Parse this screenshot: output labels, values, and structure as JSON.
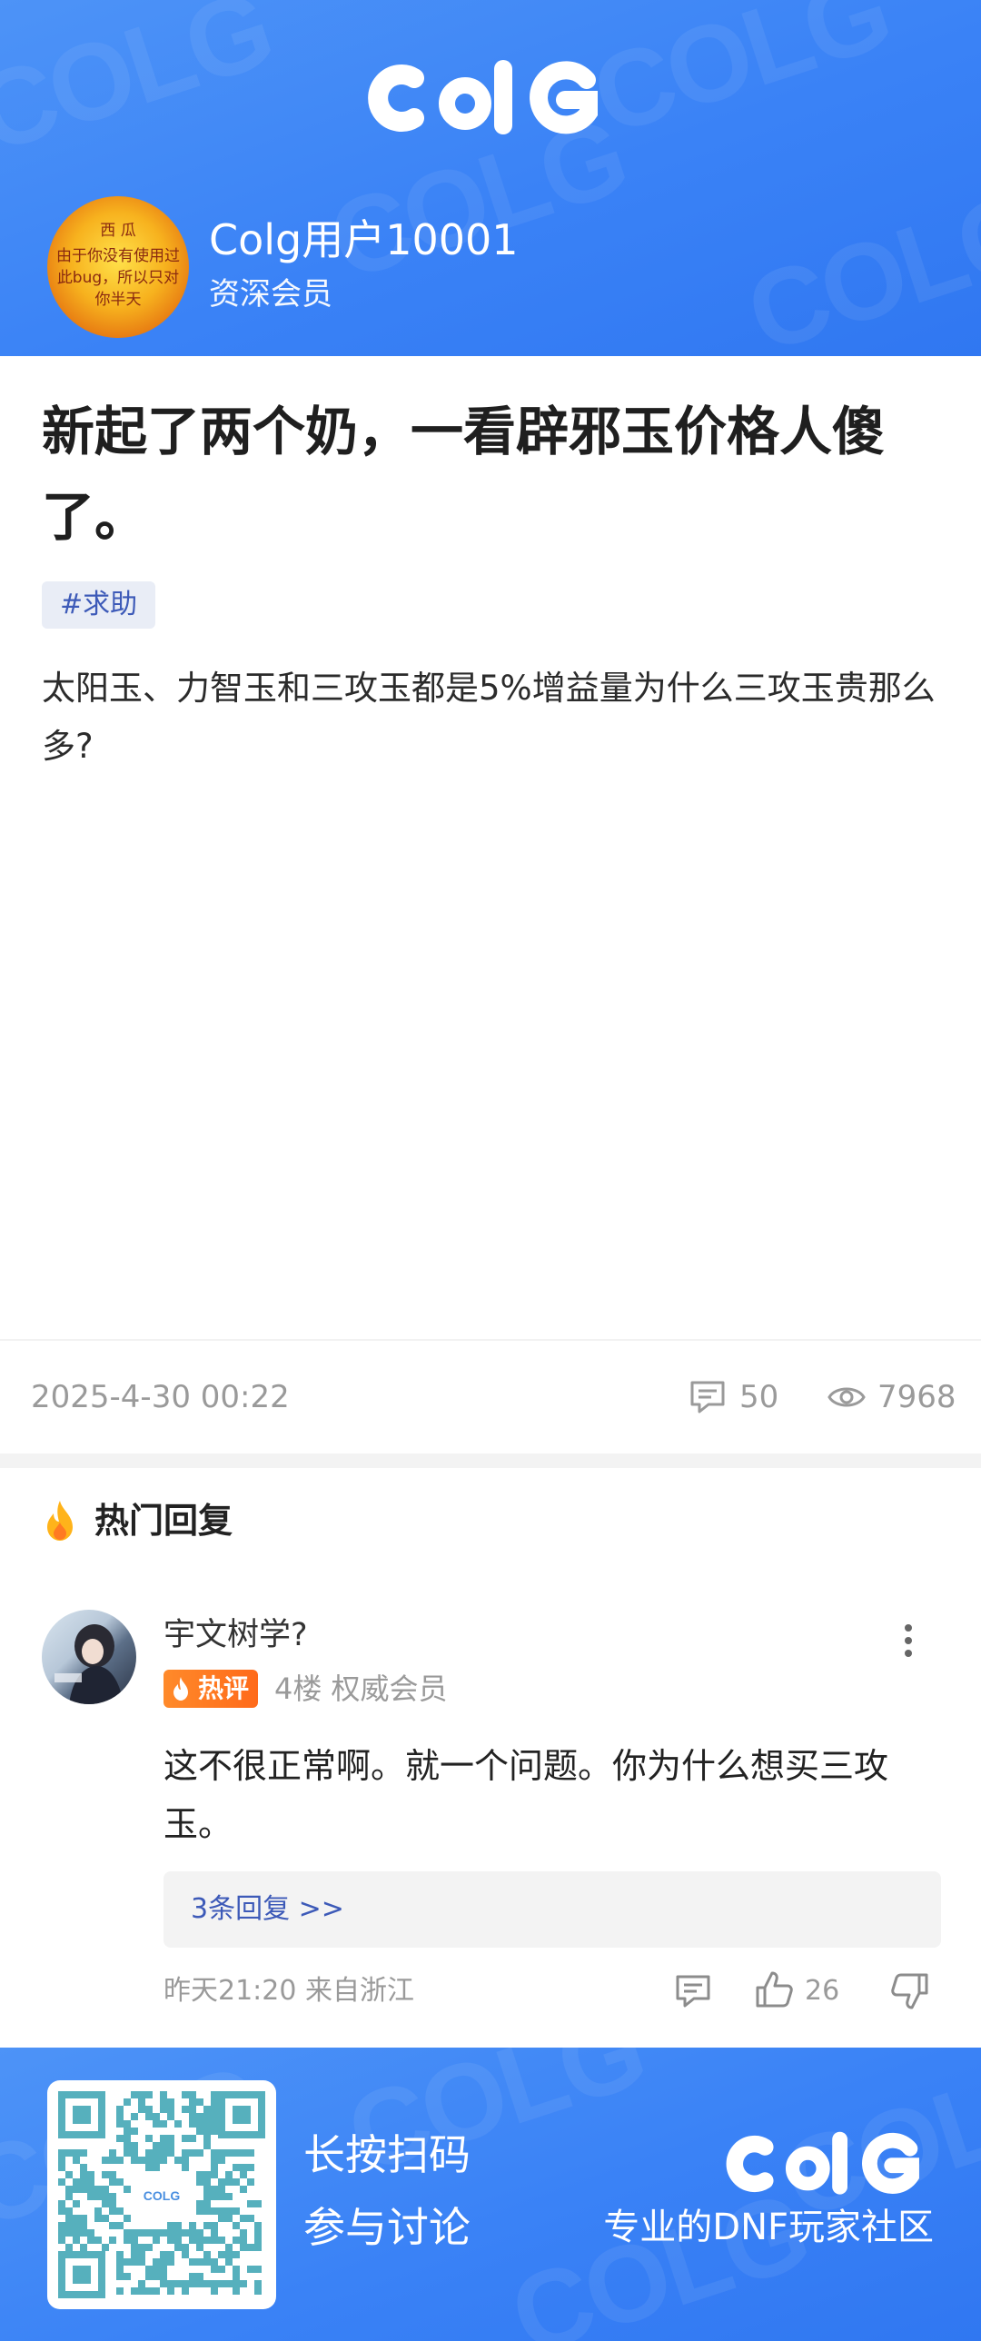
{
  "header": {
    "logo": "COLG",
    "avatar_text": [
      "西 瓜",
      "由于你没有使用过",
      "此bug，所以只对",
      "你半天"
    ],
    "username": "Colg用户10001",
    "user_level": "资深会员"
  },
  "post": {
    "title": "新起了两个奶，一看辟邪玉价格人傻了。",
    "tag": "#求助",
    "content": "太阳玉、力智玉和三攻玉都是5%增益量为什么三攻玉贵那么多?",
    "date": "2025-4-30 00:22",
    "comment_count": "50",
    "view_count": "7968"
  },
  "hot_replies": {
    "section_title": "热门回复",
    "reply": {
      "author": "宇文树学?",
      "badge": "热评",
      "floor_and_level": "4楼 权威会员",
      "text": "这不很正常啊。就一个问题。你为什么想买三攻玉。",
      "sub_replies": "3条回复 >>",
      "time_location": "昨天21:20 来自浙江",
      "like_count": "26"
    }
  },
  "footer": {
    "qr_label": "COLG",
    "line1": "长按扫码",
    "line2": "参与讨论",
    "logo": "COLG",
    "slogan": "专业的DNF玩家社区"
  },
  "colors": {
    "brand_blue": "#3a82f6",
    "tag_text": "#3d5ab8",
    "hot_orange": "#ff7a22",
    "muted": "#9a9a9a"
  }
}
